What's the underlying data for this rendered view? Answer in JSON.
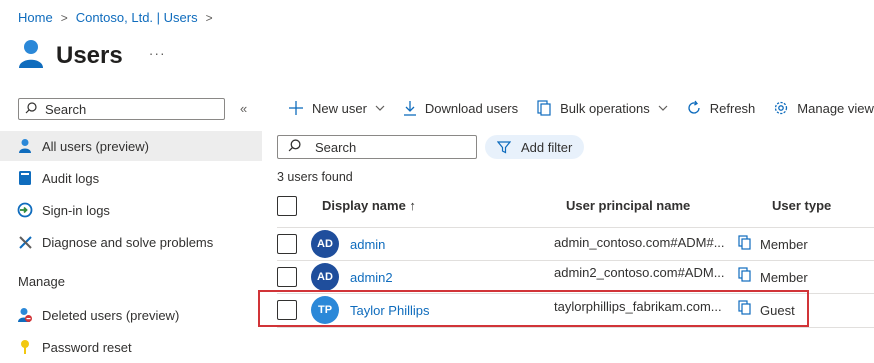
{
  "breadcrumb": [
    "Home",
    "Contoso, Ltd. | Users"
  ],
  "page": {
    "title": "Users",
    "more": "···"
  },
  "sidebar": {
    "search_placeholder": "Search",
    "collapse": "«",
    "items": [
      {
        "label": "All users (preview)",
        "icon": "user-icon",
        "selected": true
      },
      {
        "label": "Audit logs",
        "icon": "book-icon"
      },
      {
        "label": "Sign-in logs",
        "icon": "signin-icon"
      },
      {
        "label": "Diagnose and solve problems",
        "icon": "wrench-icon"
      }
    ],
    "section": "Manage",
    "manage_items": [
      {
        "label": "Deleted users (preview)",
        "icon": "deleted-user-icon"
      },
      {
        "label": "Password reset",
        "icon": "key-icon"
      }
    ]
  },
  "toolbar": {
    "new_user": "New user",
    "download_users": "Download users",
    "bulk_operations": "Bulk operations",
    "refresh": "Refresh",
    "manage_view": "Manage view"
  },
  "search": {
    "placeholder": "Search"
  },
  "filter": {
    "label": "Add filter"
  },
  "results_count": "3 users found",
  "table": {
    "columns": {
      "display_name": "Display name ↑",
      "upn": "User principal name",
      "user_type": "User type"
    },
    "rows": [
      {
        "initials": "AD",
        "name": "admin",
        "upn": "admin_contoso.com#ADM#...",
        "type": "Member",
        "avatar_color": "#1f4e9c"
      },
      {
        "initials": "AD",
        "name": "admin2",
        "upn": "admin2_contoso.com#ADM...",
        "type": "Member",
        "avatar_color": "#1f4e9c"
      },
      {
        "initials": "TP",
        "name": "Taylor Phillips",
        "upn": "taylorphillips_fabrikam.com...",
        "type": "Guest",
        "avatar_color": "#2b88d8"
      }
    ]
  },
  "colors": {
    "accent": "#0f6cbd",
    "highlight": "#d13438",
    "selected_bg": "#ededed"
  }
}
